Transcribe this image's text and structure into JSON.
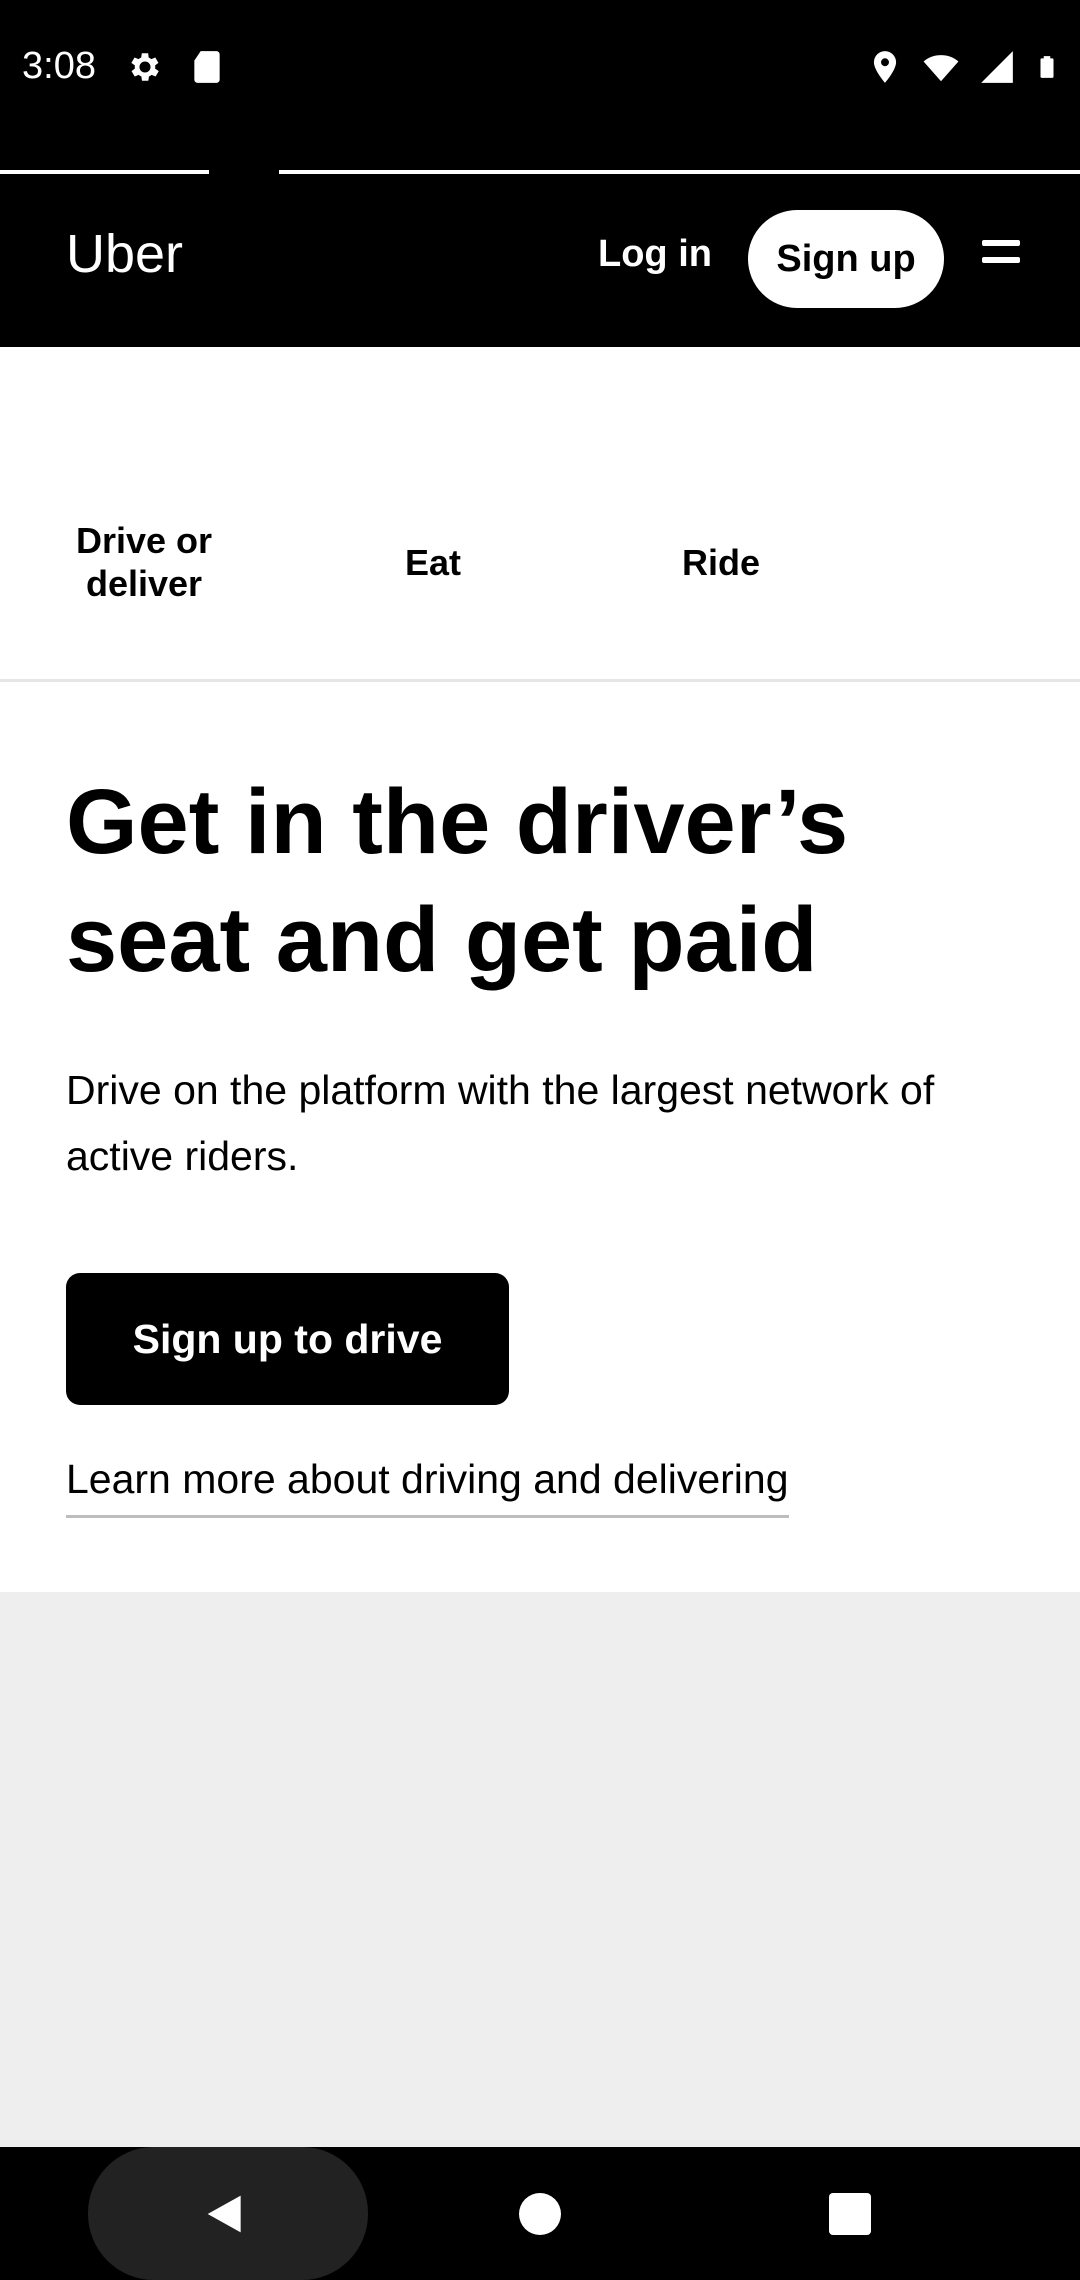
{
  "status_bar": {
    "time": "3:08",
    "left_icons": [
      "gear-icon",
      "sd-card-icon"
    ],
    "right_icons": [
      "location-icon",
      "wifi-icon",
      "signal-icon",
      "battery-icon"
    ]
  },
  "header": {
    "logo": "Uber",
    "login_label": "Log in",
    "signup_label": "Sign up",
    "menu_icon": "hamburger-menu-icon"
  },
  "nav_tabs": [
    {
      "label": "Drive or deliver"
    },
    {
      "label": "Eat"
    },
    {
      "label": "Ride"
    }
  ],
  "hero": {
    "title": "Get in the driver’s seat and get paid",
    "subtitle": "Drive on the platform with the largest network of active riders.",
    "cta_label": "Sign up to drive",
    "learn_more_label": "Learn more about driving and delivering"
  },
  "system_nav": {
    "buttons": [
      "back-icon",
      "home-icon",
      "recents-icon"
    ]
  },
  "colors": {
    "brand_black": "#000000",
    "white": "#ffffff",
    "grey_background": "#eeeeee"
  }
}
